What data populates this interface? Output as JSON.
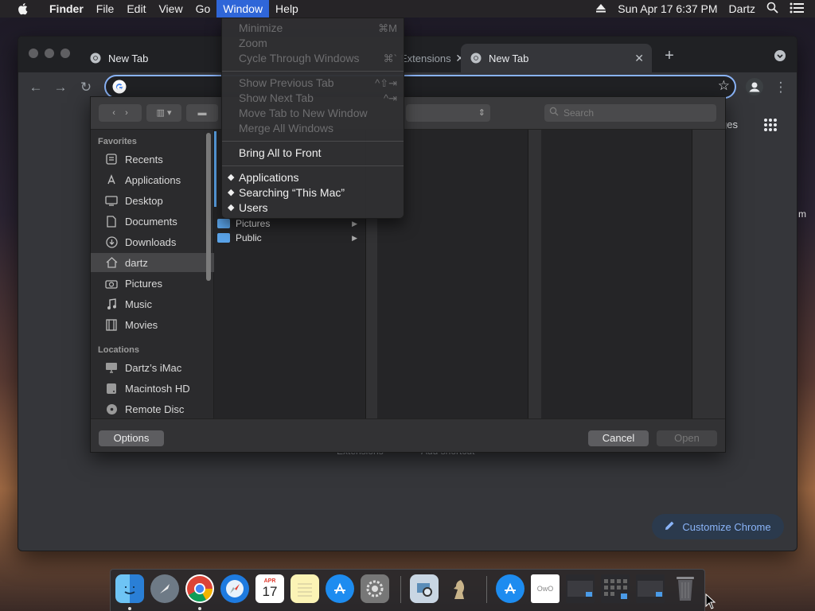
{
  "menubar": {
    "app_name": "Finder",
    "menus": [
      "File",
      "Edit",
      "View",
      "Go",
      "Window",
      "Help"
    ],
    "active_menu": "Window",
    "clock": "Sun Apr 17  6:37 PM",
    "user": "Dartz"
  },
  "window_menu": {
    "items": [
      {
        "label": "Minimize",
        "shortcut": "⌘M",
        "enabled": false
      },
      {
        "label": "Zoom",
        "shortcut": "",
        "enabled": false
      },
      {
        "label": "Cycle Through Windows",
        "shortcut": "⌘`",
        "enabled": false
      },
      {
        "label": "Show Previous Tab",
        "shortcut": "^⇧⇥",
        "enabled": false
      },
      {
        "label": "Show Next Tab",
        "shortcut": "^⇥",
        "enabled": false
      },
      {
        "label": "Move Tab to New Window",
        "shortcut": "",
        "enabled": false
      },
      {
        "label": "Merge All Windows",
        "shortcut": "",
        "enabled": false
      },
      {
        "label": "Bring All to Front",
        "shortcut": "",
        "enabled": true
      },
      {
        "label": "Applications",
        "shortcut": "",
        "enabled": true,
        "diamond": true
      },
      {
        "label": "Searching “This Mac”",
        "shortcut": "",
        "enabled": true,
        "diamond": true
      },
      {
        "label": "Users",
        "shortcut": "",
        "enabled": true,
        "diamond": true
      }
    ]
  },
  "chrome": {
    "tabs": [
      {
        "title": "New Tab"
      },
      {
        "title": "Extensions"
      },
      {
        "title": "New Tab"
      }
    ],
    "omnibox_value": "",
    "customize_label": "Customize Chrome",
    "partial_text": {
      "right": "ges",
      "edge": "m",
      "extensions": "Extensions",
      "add_shortcut": "Add shortcut"
    }
  },
  "dialog": {
    "search_placeholder": "Search",
    "favorites_header": "Favorites",
    "favorites": [
      {
        "label": "Recents",
        "icon": "clock-icon"
      },
      {
        "label": "Applications",
        "icon": "applications-icon"
      },
      {
        "label": "Desktop",
        "icon": "desktop-icon"
      },
      {
        "label": "Documents",
        "icon": "document-icon"
      },
      {
        "label": "Downloads",
        "icon": "download-icon"
      },
      {
        "label": "dartz",
        "icon": "home-icon",
        "selected": true
      },
      {
        "label": "Pictures",
        "icon": "camera-icon"
      },
      {
        "label": "Music",
        "icon": "music-icon"
      },
      {
        "label": "Movies",
        "icon": "film-icon"
      }
    ],
    "locations_header": "Locations",
    "locations": [
      {
        "label": "Dartz’s iMac",
        "icon": "imac-icon"
      },
      {
        "label": "Macintosh HD",
        "icon": "disk-icon"
      },
      {
        "label": "Remote Disc",
        "icon": "disc-icon"
      }
    ],
    "column_items": [
      {
        "label": "Pictures"
      },
      {
        "label": "Public"
      }
    ],
    "options_label": "Options",
    "cancel_label": "Cancel",
    "open_label": "Open"
  },
  "dock": {
    "apps": [
      "finder-icon",
      "launchpad-icon",
      "chrome-icon",
      "safari-icon",
      "calendar-icon",
      "notes-icon",
      "app-store-icon",
      "system-preferences-icon",
      "preview-icon",
      "chess-icon",
      "app-store-icon",
      "owo-app-icon",
      "window-thumbnail-icon",
      "window-thumbnail-icon",
      "window-thumbnail-icon",
      "trash-icon"
    ],
    "calendar_month": "APR",
    "calendar_day": "17",
    "owo_text": "OwO"
  }
}
